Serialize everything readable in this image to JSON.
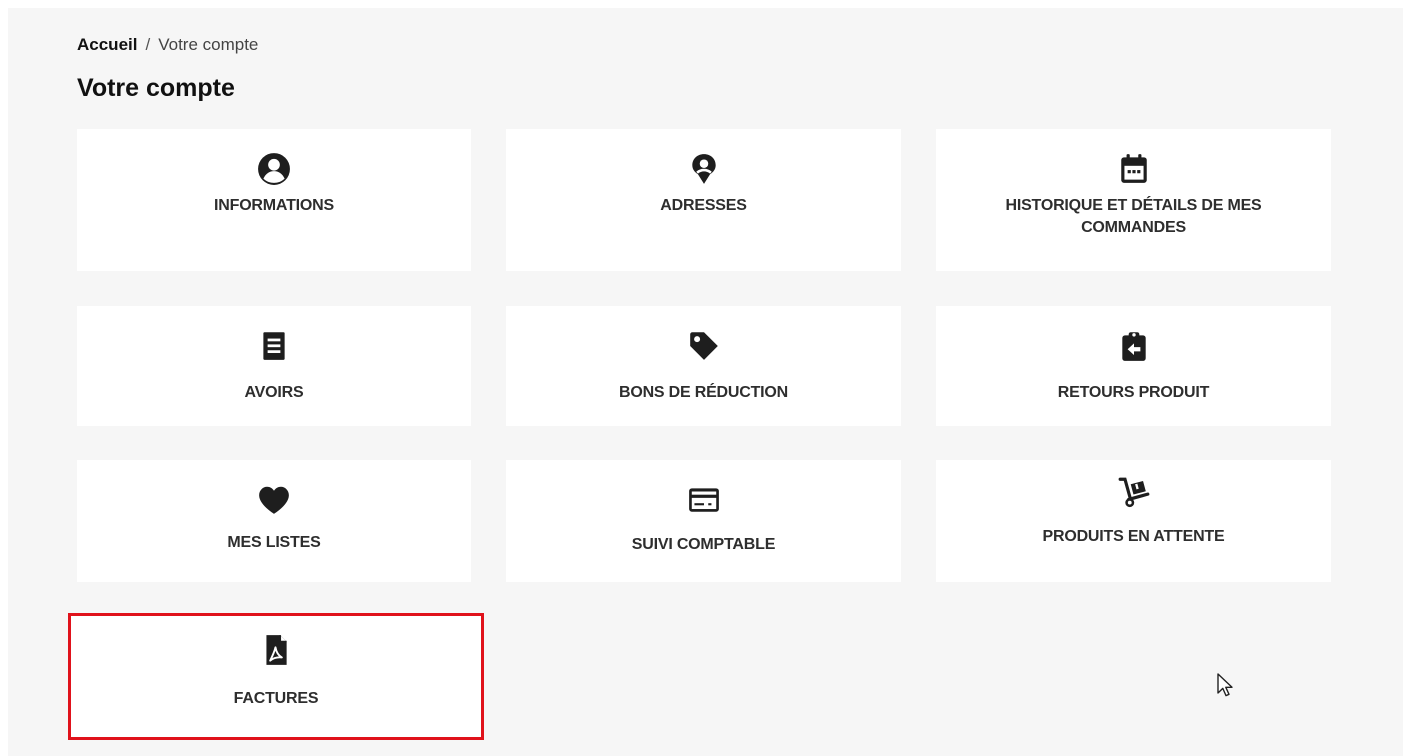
{
  "breadcrumb": {
    "home": "Accueil",
    "separator": "/",
    "current": "Votre compte"
  },
  "page_title": "Votre compte",
  "tiles": [
    {
      "label": "INFORMATIONS",
      "icon": "account-circle-icon"
    },
    {
      "label": "ADRESSES",
      "icon": "map-pin-icon"
    },
    {
      "label": "HISTORIQUE ET DÉTAILS DE MES COMMANDES",
      "icon": "calendar-icon"
    },
    {
      "label": "AVOIRS",
      "icon": "receipt-icon"
    },
    {
      "label": "BONS DE RÉDUCTION",
      "icon": "tag-icon"
    },
    {
      "label": "RETOURS PRODUIT",
      "icon": "return-clipboard-icon"
    },
    {
      "label": "MES LISTES",
      "icon": "heart-icon"
    },
    {
      "label": "SUIVI COMPTABLE",
      "icon": "credit-card-icon"
    },
    {
      "label": "PRODUITS EN ATTENTE",
      "icon": "hand-truck-icon"
    },
    {
      "label": "FACTURES",
      "icon": "pdf-file-icon"
    }
  ],
  "colors": {
    "highlight": "#e0121b",
    "background": "#f6f6f6",
    "tile": "#ffffff"
  }
}
